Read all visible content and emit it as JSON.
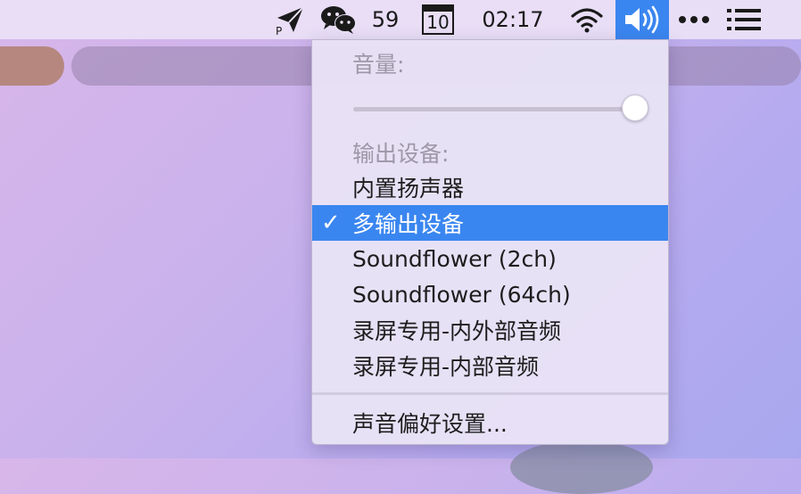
{
  "menubar": {
    "battery_count": "59",
    "calendar_day": "10",
    "clock": "02:17",
    "icons": [
      "paper-plane-p-icon",
      "wechat-icon",
      "calendar-icon",
      "wifi-icon",
      "volume-icon",
      "more-icon",
      "list-icon"
    ]
  },
  "sound_menu": {
    "volume_label": "音量:",
    "volume_level": 1.0,
    "output_label": "输出设备:",
    "devices": [
      {
        "label": "内置扬声器",
        "selected": false
      },
      {
        "label": "多输出设备",
        "selected": true
      },
      {
        "label": "Soundflower (2ch)",
        "selected": false
      },
      {
        "label": "Soundflower (64ch)",
        "selected": false
      },
      {
        "label": "录屏专用-内外部音频",
        "selected": false
      },
      {
        "label": "录屏专用-内部音频",
        "selected": false
      }
    ],
    "check_mark": "✓",
    "preferences_label": "声音偏好设置..."
  },
  "colors": {
    "accent": "#3a86f0",
    "menubar_bg": "#ece2f6",
    "menu_bg": "#e8e2f6"
  }
}
